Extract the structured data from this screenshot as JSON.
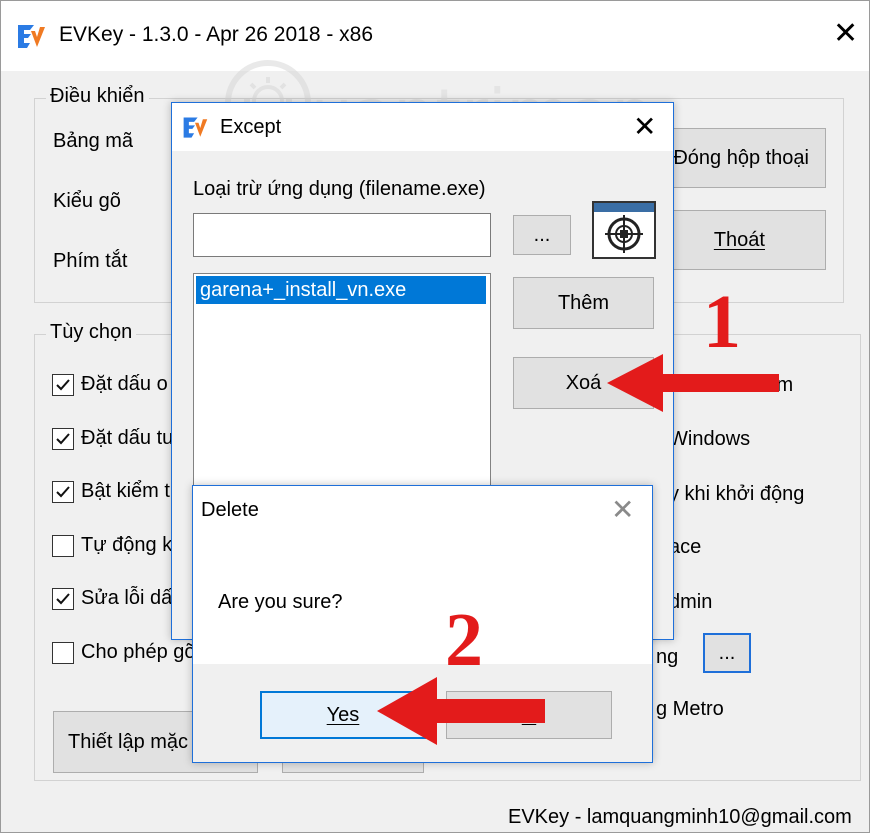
{
  "main": {
    "title": "EVKey - 1.3.0 - Apr 26 2018 - x86",
    "close_glyph": "✕",
    "group_control": {
      "legend": "Điều khiển",
      "labels": [
        "Bảng mã",
        "Kiểu gõ",
        "Phím tắt"
      ],
      "btn_close_dialog": "Đóng hộp thoại",
      "btn_exit": "Thoát"
    },
    "group_options": {
      "legend": "Tùy chọn",
      "left_items": [
        {
          "label": "Đặt dấu o",
          "checked": true
        },
        {
          "label": "Đặt dấu tu",
          "checked": true
        },
        {
          "label": "Bật kiểm t",
          "checked": true
        },
        {
          "label": "Tự động k",
          "checked": false
        },
        {
          "label": "Sửa lỗi dấ",
          "checked": true
        },
        {
          "label": "Cho phép gõ",
          "checked": false
        }
      ],
      "right_items": [
        "ím",
        "Windows",
        "y khi khởi động",
        "ace",
        "dmin",
        "ng",
        "g Metro"
      ],
      "ellipsis_button": "..."
    },
    "btn_default": "Thiết lập mặc",
    "footer": "EVKey - lamquangminh10@gmail.com"
  },
  "except_dialog": {
    "title": "Except",
    "close_glyph": "✕",
    "field_label": "Loại trừ ứng dụng (filename.exe)",
    "field_value": "",
    "browse_button": "...",
    "crosshair_icon": "crosshair-target-icon",
    "list_items": [
      "garena+_install_vn.exe"
    ],
    "btn_add": "Thêm",
    "btn_delete": "Xoá"
  },
  "delete_dialog": {
    "title": "Delete",
    "close_glyph": "✕",
    "message": "Are you sure?",
    "btn_yes": "Yes",
    "btn_no": "N"
  },
  "annotations": {
    "step1": "1",
    "step2": "2",
    "arrow_color": "#e31b1b"
  },
  "watermark": {
    "text": "uantrimang"
  },
  "colors": {
    "accent": "#0078d7",
    "window_bg": "#f0f0f0",
    "button_bg": "#e1e1e1"
  }
}
